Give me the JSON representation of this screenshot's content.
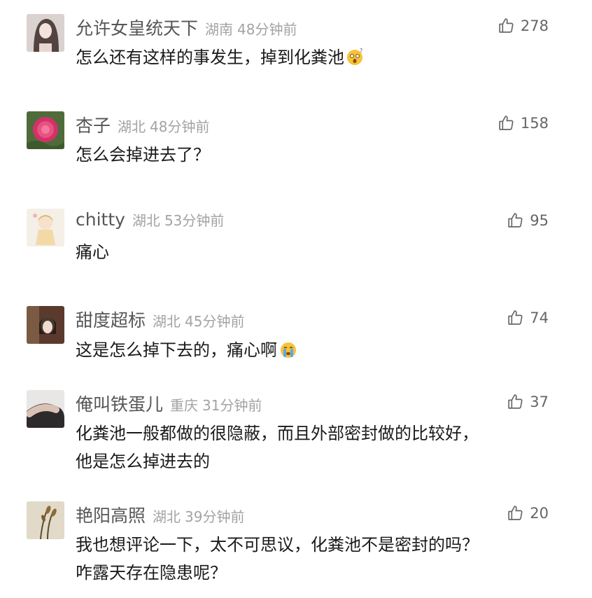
{
  "comments": [
    {
      "username": "允许女皇统天下",
      "location": "湖南",
      "time": "48分钟前",
      "likes": "278",
      "text": "怎么还有这样的事发生，掉到化粪池",
      "emoji": "dizzy-face-emoji",
      "avatar": "avatar-girl"
    },
    {
      "username": "杏子",
      "location": "湖北",
      "time": "48分钟前",
      "likes": "158",
      "text": "怎么会掉进去了？",
      "avatar": "avatar-peony"
    },
    {
      "username": "chitty",
      "location": "湖北",
      "time": "53分钟前",
      "likes": "95",
      "text": "痛心",
      "avatar": "avatar-cartoon-girl"
    },
    {
      "username": "甜度超标",
      "location": "湖北",
      "time": "45分钟前",
      "likes": "74",
      "text": "这是怎么掉下去的，痛心啊",
      "emoji": "crying-face-emoji",
      "avatar": "avatar-photo"
    },
    {
      "username": "俺叫铁蛋儿",
      "location": "重庆",
      "time": "31分钟前",
      "likes": "37",
      "text_lines": [
        "化粪池一般都做的很隐蔽，而且外部密封做的比较好，",
        "他是怎么掉进去的"
      ],
      "avatar": "avatar-arm"
    },
    {
      "username": "艳阳高照",
      "location": "湖北",
      "time": "39分钟前",
      "likes": "20",
      "text_lines": [
        "我也想评论一下，太不可思议，化粪池不是密封的吗？",
        "咋露天存在隐患呢？"
      ],
      "avatar": "avatar-reeds"
    }
  ],
  "icons": {
    "like": "thumbs-up-icon"
  },
  "colors": {
    "username": "#565656",
    "meta": "#a3a3a3",
    "text": "#1a1a1a",
    "like": "#666666"
  }
}
